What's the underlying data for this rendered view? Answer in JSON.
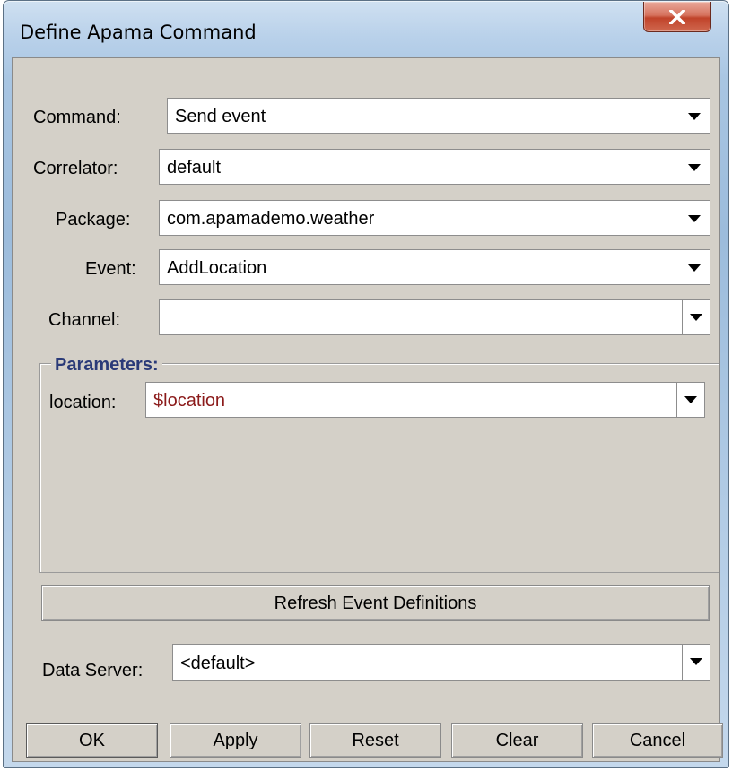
{
  "window": {
    "title": "Define Apama Command"
  },
  "fields": {
    "command": {
      "label": "Command:",
      "value": "Send event"
    },
    "correlator": {
      "label": "Correlator:",
      "value": "default"
    },
    "package": {
      "label": "Package:",
      "value": "com.apamademo.weather"
    },
    "event": {
      "label": "Event:",
      "value": "AddLocation"
    },
    "channel": {
      "label": "Channel:",
      "value": ""
    }
  },
  "parameters": {
    "legend": "Parameters:",
    "items": [
      {
        "label": "location:",
        "value": "$location",
        "value_color": "#8b1a1a"
      }
    ]
  },
  "refresh_button": "Refresh Event Definitions",
  "data_server": {
    "label": "Data Server:",
    "value": "<default>"
  },
  "footer_buttons": {
    "ok": "OK",
    "apply": "Apply",
    "reset": "Reset",
    "clear": "Clear",
    "cancel": "Cancel"
  },
  "icons": {
    "close": "close-x-icon",
    "dropdown": "chevron-down-icon"
  }
}
